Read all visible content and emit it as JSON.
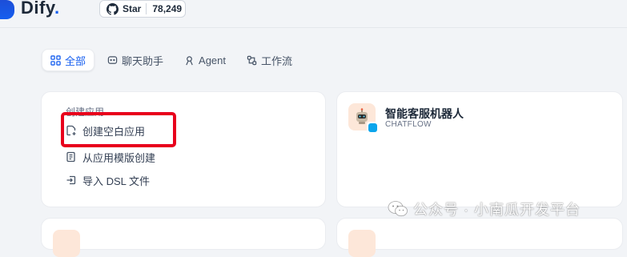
{
  "header": {
    "logo_text": "Dify",
    "logo_dot": ".",
    "star_label": "Star",
    "star_count": "78,249"
  },
  "tabs": [
    {
      "label": "全部",
      "icon": "grid-icon",
      "active": true
    },
    {
      "label": "聊天助手",
      "icon": "chat-icon",
      "active": false
    },
    {
      "label": "Agent",
      "icon": "agent-icon",
      "active": false
    },
    {
      "label": "工作流",
      "icon": "workflow-icon",
      "active": false
    }
  ],
  "create_card": {
    "title": "创建应用",
    "items": [
      {
        "label": "创建空白应用",
        "icon": "new-file-icon"
      },
      {
        "label": "从应用模版创建",
        "icon": "template-icon"
      },
      {
        "label": "导入 DSL 文件",
        "icon": "import-icon"
      }
    ]
  },
  "app_card": {
    "name": "智能客服机器人",
    "mode": "CHATFLOW",
    "icon": "robot-icon"
  },
  "watermark": {
    "text": "公众号 · 小南瓜开发平台",
    "icon": "wechat-icon"
  },
  "colors": {
    "accent": "#155eef",
    "highlight": "#e8001c"
  }
}
